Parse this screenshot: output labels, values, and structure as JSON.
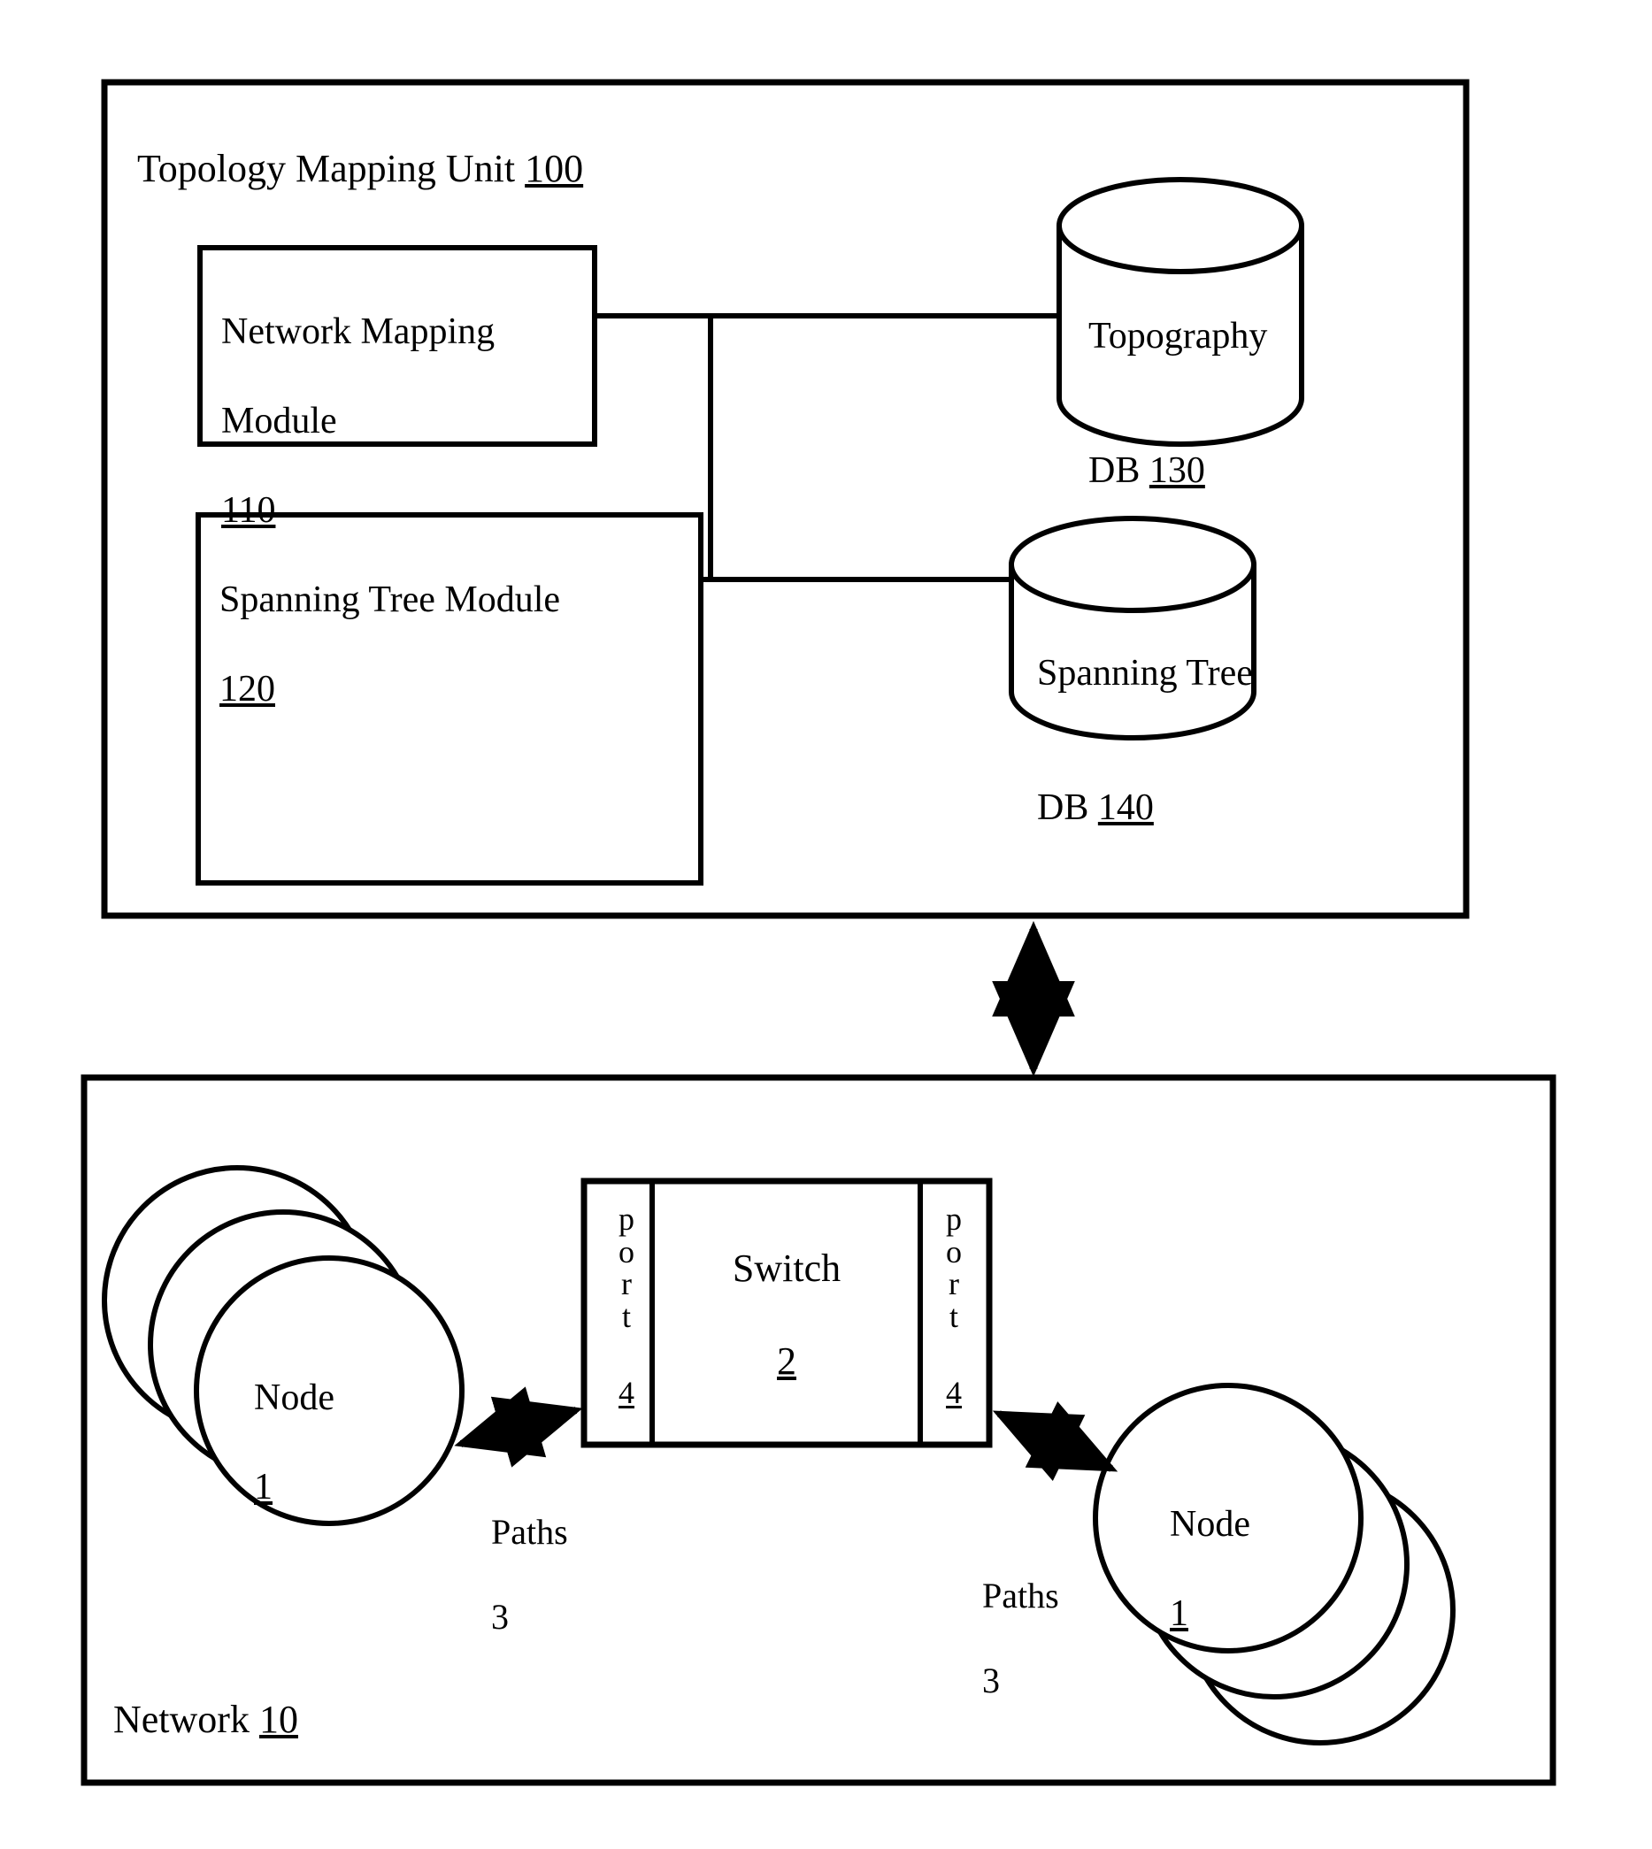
{
  "figure": {
    "style": "patent-line-drawing",
    "stroke_color": "#000000",
    "background_color": "#ffffff"
  },
  "topology_unit": {
    "title_text": "Topology Mapping Unit ",
    "title_ref": "100",
    "network_mapping_module": {
      "line1": "Network Mapping",
      "line2": "Module",
      "ref": "110"
    },
    "spanning_tree_module": {
      "line1": "Spanning Tree Module",
      "ref": "120"
    },
    "topography_db": {
      "line1": "Topography",
      "line2_prefix": "DB ",
      "ref": "130"
    },
    "spanning_tree_db": {
      "line1": "Spanning Tree",
      "line2_prefix": "DB ",
      "ref": "140"
    }
  },
  "network": {
    "label_text": "Network ",
    "label_ref": "10",
    "switch": {
      "name": "Switch",
      "ref": "2",
      "left_port": {
        "letters": "p\no\nr\nt",
        "ref": "4"
      },
      "right_port": {
        "letters": "p\no\nr\nt",
        "ref": "4"
      }
    },
    "left_nodes": {
      "name": "Node",
      "ref": "1",
      "count": 3
    },
    "right_nodes": {
      "name": "Node",
      "ref": "1",
      "count": 3
    },
    "left_link": {
      "line1": "Paths",
      "line2": "3"
    },
    "right_link": {
      "line1": "Paths",
      "line2": "3"
    }
  }
}
